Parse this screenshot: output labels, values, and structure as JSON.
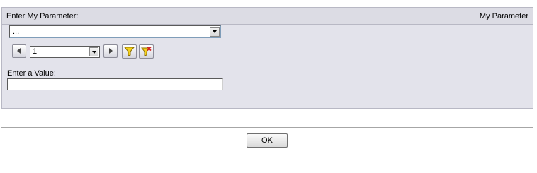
{
  "panel": {
    "title": "Enter My Parameter:",
    "name": "My Parameter"
  },
  "parameter_select": {
    "value": "..."
  },
  "pager": {
    "page_value": "1",
    "prev_icon": "chevron-left-icon",
    "next_icon": "chevron-right-icon",
    "filter_icon": "funnel-icon",
    "clear_filter_icon": "funnel-clear-icon"
  },
  "value_entry": {
    "label": "Enter a Value:",
    "value": ""
  },
  "footer": {
    "ok_label": "OK"
  },
  "colors": {
    "panel_bg": "#e3e3eb",
    "panel_border": "#b8b8c4",
    "funnel_yellow": "#f5d21b",
    "clear_red": "#d02020"
  }
}
